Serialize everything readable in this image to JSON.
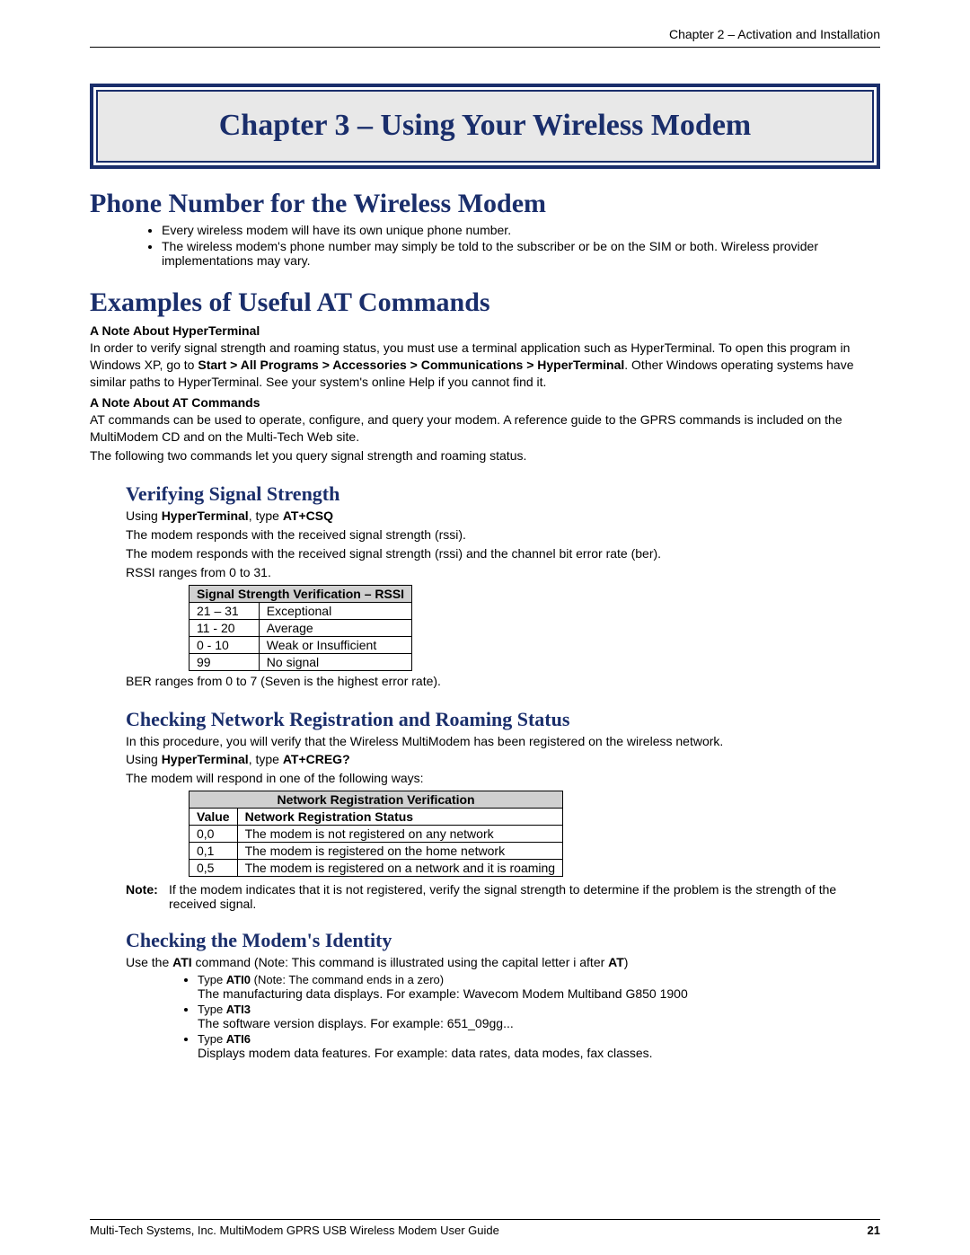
{
  "header": {
    "chapter_line": "Chapter 2 – Activation and Installation"
  },
  "title": "Chapter 3 – Using Your Wireless Modem",
  "section1": {
    "heading": "Phone Number for the Wireless Modem",
    "bullets": [
      "Every wireless modem will have its own unique phone number.",
      "The wireless modem's phone number may simply be told to the subscriber or be on the SIM or both. Wireless provider implementations may vary."
    ]
  },
  "section2": {
    "heading": "Examples of Useful AT Commands",
    "note1_label": "A Note About HyperTerminal",
    "note1_p1_a": "In order to verify signal strength and roaming status, you must use a terminal application such as HyperTerminal. To open this program in Windows XP, go to ",
    "note1_p1_b": "Start > All Programs > Accessories > Communications > HyperTerminal",
    "note1_p1_c": ". Other Windows operating systems have similar paths to HyperTerminal. See your system's online Help if you cannot find it.",
    "note2_label": "A Note About AT Commands",
    "note2_p1": "AT commands can be used to operate, configure, and query your modem. A reference guide to the GPRS commands is included on the MultiModem CD and on the Multi-Tech Web site.",
    "note2_p2": "The following two commands let you query signal strength and roaming status."
  },
  "sub1": {
    "heading": "Verifying Signal Strength",
    "l1_a": "Using ",
    "l1_b": "HyperTerminal",
    "l1_c": ", type ",
    "l1_d": "AT+CSQ",
    "l2": "The modem responds with the received signal strength (rssi).",
    "l3": "The modem responds with the received signal strength (rssi) and the channel bit error rate (ber).",
    "l4": "RSSI ranges from 0 to 31.",
    "table_title": "Signal Strength Verification – RSSI",
    "rows": [
      [
        "21 – 31",
        "Exceptional"
      ],
      [
        "11 - 20",
        "Average"
      ],
      [
        "0 - 10",
        "Weak or Insufficient"
      ],
      [
        "99",
        "No signal"
      ]
    ],
    "after": "BER ranges from 0 to 7 (Seven is the highest error rate)."
  },
  "sub2": {
    "heading": "Checking Network Registration and Roaming Status",
    "p1": "In this procedure, you will verify that the Wireless MultiModem has been registered on the wireless network.",
    "l1_a": "Using ",
    "l1_b": "HyperTerminal",
    "l1_c": ", type ",
    "l1_d": "AT+CREG?",
    "p2": "The modem will respond in one of the following ways:",
    "table_title": "Network Registration Verification",
    "col1": "Value",
    "col2": "Network Registration Status",
    "rows": [
      [
        "0,0",
        "The modem is not registered on any network"
      ],
      [
        "0,1",
        "The modem is registered on the home network"
      ],
      [
        "0,5",
        "The modem is registered on a network and it is roaming"
      ]
    ],
    "note_label": "Note:",
    "note_text": "If the modem indicates that it is not registered, verify the signal strength to determine if the problem is the strength of the received signal."
  },
  "sub3": {
    "heading": "Checking the Modem's Identity",
    "l1_a": "Use the ",
    "l1_b": "ATI",
    "l1_c": " command (Note: This command is illustrated using the capital letter i after ",
    "l1_d": "AT",
    "l1_e": ")",
    "items": [
      {
        "t1": "Type ",
        "b": "ATI0",
        "t2": " (Note: The command ends in a zero)",
        "line2": "The manufacturing data displays. For example: Wavecom Modem Multiband G850 1900"
      },
      {
        "t1": "Type ",
        "b": "ATI3",
        "t2": "",
        "line2": "The software version displays. For example: 651_09gg..."
      },
      {
        "t1": "Type ",
        "b": "ATI6",
        "t2": "",
        "line2": "Displays modem data features. For example: data rates, data modes, fax classes."
      }
    ]
  },
  "footer": {
    "text": "Multi-Tech Systems, Inc. MultiModem GPRS USB Wireless Modem User Guide",
    "page": "21"
  }
}
